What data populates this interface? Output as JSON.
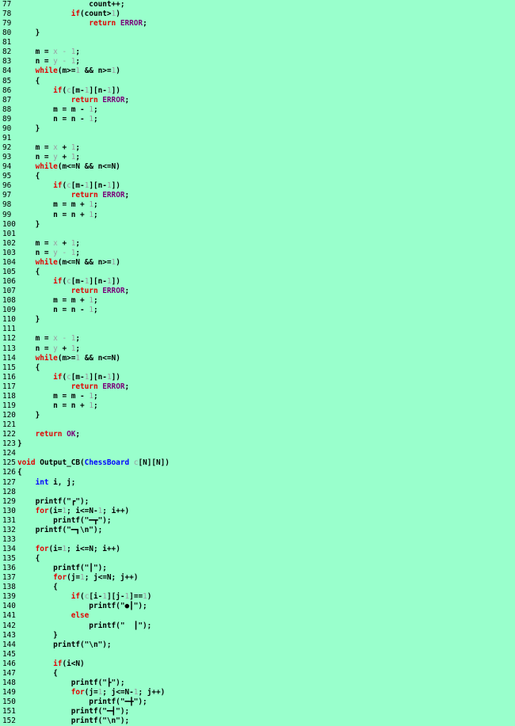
{
  "editor": {
    "colors": {
      "background": "#99ffcc",
      "keyword": "#e00000",
      "type": "#0000ff",
      "number": "#9a9aa0",
      "macro": "#7a007a",
      "text": "#000000"
    },
    "lines": [
      {
        "n": "77",
        "t": [
          [
            "i",
            "                count++;"
          ]
        ]
      },
      {
        "n": "78",
        "t": [
          [
            "i",
            "            "
          ],
          [
            "k",
            "if"
          ],
          [
            "i",
            "(count>"
          ],
          [
            "d",
            "1"
          ],
          [
            "i",
            ")"
          ]
        ]
      },
      {
        "n": "79",
        "t": [
          [
            "i",
            "                "
          ],
          [
            "k",
            "return"
          ],
          [
            "i",
            " "
          ],
          [
            "m",
            "ERROR"
          ],
          [
            "i",
            ";"
          ]
        ]
      },
      {
        "n": "80",
        "t": [
          [
            "i",
            "    }"
          ]
        ]
      },
      {
        "n": "81",
        "t": []
      },
      {
        "n": "82",
        "t": [
          [
            "i",
            "    m = "
          ],
          [
            "d",
            "x - 1"
          ],
          [
            "i",
            ";"
          ]
        ]
      },
      {
        "n": "83",
        "t": [
          [
            "i",
            "    n = "
          ],
          [
            "d",
            "y - 1"
          ],
          [
            "i",
            ";"
          ]
        ]
      },
      {
        "n": "84",
        "t": [
          [
            "i",
            "    "
          ],
          [
            "k",
            "while"
          ],
          [
            "i",
            "(m>="
          ],
          [
            "d",
            "1"
          ],
          [
            "i",
            " && n>="
          ],
          [
            "d",
            "1"
          ],
          [
            "i",
            ")"
          ]
        ]
      },
      {
        "n": "85",
        "t": [
          [
            "i",
            "    {"
          ]
        ]
      },
      {
        "n": "86",
        "t": [
          [
            "i",
            "        "
          ],
          [
            "k",
            "if"
          ],
          [
            "i",
            "("
          ],
          [
            "d",
            "c"
          ],
          [
            "i",
            "[m-"
          ],
          [
            "d",
            "1"
          ],
          [
            "i",
            "][n-"
          ],
          [
            "d",
            "1"
          ],
          [
            "i",
            "])"
          ]
        ]
      },
      {
        "n": "87",
        "t": [
          [
            "i",
            "            "
          ],
          [
            "k",
            "return"
          ],
          [
            "i",
            " "
          ],
          [
            "m",
            "ERROR"
          ],
          [
            "i",
            ";"
          ]
        ]
      },
      {
        "n": "88",
        "t": [
          [
            "i",
            "        m = m - "
          ],
          [
            "d",
            "1"
          ],
          [
            "i",
            ";"
          ]
        ]
      },
      {
        "n": "89",
        "t": [
          [
            "i",
            "        n = n - "
          ],
          [
            "d",
            "1"
          ],
          [
            "i",
            ";"
          ]
        ]
      },
      {
        "n": "90",
        "t": [
          [
            "i",
            "    }"
          ]
        ]
      },
      {
        "n": "91",
        "t": []
      },
      {
        "n": "92",
        "t": [
          [
            "i",
            "    m = "
          ],
          [
            "d",
            "x"
          ],
          [
            "i",
            " + "
          ],
          [
            "d",
            "1"
          ],
          [
            "i",
            ";"
          ]
        ]
      },
      {
        "n": "93",
        "t": [
          [
            "i",
            "    n = "
          ],
          [
            "d",
            "y"
          ],
          [
            "i",
            " + "
          ],
          [
            "d",
            "1"
          ],
          [
            "i",
            ";"
          ]
        ]
      },
      {
        "n": "94",
        "t": [
          [
            "i",
            "    "
          ],
          [
            "k",
            "while"
          ],
          [
            "i",
            "(m<=N && n<=N)"
          ]
        ]
      },
      {
        "n": "95",
        "t": [
          [
            "i",
            "    {"
          ]
        ]
      },
      {
        "n": "96",
        "t": [
          [
            "i",
            "        "
          ],
          [
            "k",
            "if"
          ],
          [
            "i",
            "("
          ],
          [
            "d",
            "c"
          ],
          [
            "i",
            "[m-"
          ],
          [
            "d",
            "1"
          ],
          [
            "i",
            "][n-"
          ],
          [
            "d",
            "1"
          ],
          [
            "i",
            "])"
          ]
        ]
      },
      {
        "n": "97",
        "t": [
          [
            "i",
            "            "
          ],
          [
            "k",
            "return"
          ],
          [
            "i",
            " "
          ],
          [
            "m",
            "ERROR"
          ],
          [
            "i",
            ";"
          ]
        ]
      },
      {
        "n": "98",
        "t": [
          [
            "i",
            "        m = m + "
          ],
          [
            "d",
            "1"
          ],
          [
            "i",
            ";"
          ]
        ]
      },
      {
        "n": "99",
        "t": [
          [
            "i",
            "        n = n + "
          ],
          [
            "d",
            "1"
          ],
          [
            "i",
            ";"
          ]
        ]
      },
      {
        "n": "100",
        "t": [
          [
            "i",
            "    }"
          ]
        ]
      },
      {
        "n": "101",
        "t": []
      },
      {
        "n": "102",
        "t": [
          [
            "i",
            "    m = "
          ],
          [
            "d",
            "x"
          ],
          [
            "i",
            " + "
          ],
          [
            "d",
            "1"
          ],
          [
            "i",
            ";"
          ]
        ]
      },
      {
        "n": "103",
        "t": [
          [
            "i",
            "    n = "
          ],
          [
            "d",
            "y - 1"
          ],
          [
            "i",
            ";"
          ]
        ]
      },
      {
        "n": "104",
        "t": [
          [
            "i",
            "    "
          ],
          [
            "k",
            "while"
          ],
          [
            "i",
            "(m<=N && n>="
          ],
          [
            "d",
            "1"
          ],
          [
            "i",
            ")"
          ]
        ]
      },
      {
        "n": "105",
        "t": [
          [
            "i",
            "    {"
          ]
        ]
      },
      {
        "n": "106",
        "t": [
          [
            "i",
            "        "
          ],
          [
            "k",
            "if"
          ],
          [
            "i",
            "("
          ],
          [
            "d",
            "c"
          ],
          [
            "i",
            "[m-"
          ],
          [
            "d",
            "1"
          ],
          [
            "i",
            "][n-"
          ],
          [
            "d",
            "1"
          ],
          [
            "i",
            "])"
          ]
        ]
      },
      {
        "n": "107",
        "t": [
          [
            "i",
            "            "
          ],
          [
            "k",
            "return"
          ],
          [
            "i",
            " "
          ],
          [
            "m",
            "ERROR"
          ],
          [
            "i",
            ";"
          ]
        ]
      },
      {
        "n": "108",
        "t": [
          [
            "i",
            "        m = m + "
          ],
          [
            "d",
            "1"
          ],
          [
            "i",
            ";"
          ]
        ]
      },
      {
        "n": "109",
        "t": [
          [
            "i",
            "        n = n - "
          ],
          [
            "d",
            "1"
          ],
          [
            "i",
            ";"
          ]
        ]
      },
      {
        "n": "110",
        "t": [
          [
            "i",
            "    }"
          ]
        ]
      },
      {
        "n": "111",
        "t": []
      },
      {
        "n": "112",
        "t": [
          [
            "i",
            "    m = "
          ],
          [
            "d",
            "x - 1"
          ],
          [
            "i",
            ";"
          ]
        ]
      },
      {
        "n": "113",
        "t": [
          [
            "i",
            "    n = "
          ],
          [
            "d",
            "y"
          ],
          [
            "i",
            " + "
          ],
          [
            "d",
            "1"
          ],
          [
            "i",
            ";"
          ]
        ]
      },
      {
        "n": "114",
        "t": [
          [
            "i",
            "    "
          ],
          [
            "k",
            "while"
          ],
          [
            "i",
            "(m>="
          ],
          [
            "d",
            "1"
          ],
          [
            "i",
            " && n<=N)"
          ]
        ]
      },
      {
        "n": "115",
        "t": [
          [
            "i",
            "    {"
          ]
        ]
      },
      {
        "n": "116",
        "t": [
          [
            "i",
            "        "
          ],
          [
            "k",
            "if"
          ],
          [
            "i",
            "("
          ],
          [
            "d",
            "c"
          ],
          [
            "i",
            "[m-"
          ],
          [
            "d",
            "1"
          ],
          [
            "i",
            "][n-"
          ],
          [
            "d",
            "1"
          ],
          [
            "i",
            "])"
          ]
        ]
      },
      {
        "n": "117",
        "t": [
          [
            "i",
            "            "
          ],
          [
            "k",
            "return"
          ],
          [
            "i",
            " "
          ],
          [
            "m",
            "ERROR"
          ],
          [
            "i",
            ";"
          ]
        ]
      },
      {
        "n": "118",
        "t": [
          [
            "i",
            "        m = m - "
          ],
          [
            "d",
            "1"
          ],
          [
            "i",
            ";"
          ]
        ]
      },
      {
        "n": "119",
        "t": [
          [
            "i",
            "        n = n + "
          ],
          [
            "d",
            "1"
          ],
          [
            "i",
            ";"
          ]
        ]
      },
      {
        "n": "120",
        "t": [
          [
            "i",
            "    }"
          ]
        ]
      },
      {
        "n": "121",
        "t": []
      },
      {
        "n": "122",
        "t": [
          [
            "i",
            "    "
          ],
          [
            "k",
            "return"
          ],
          [
            "i",
            " "
          ],
          [
            "m",
            "OK"
          ],
          [
            "i",
            ";"
          ]
        ]
      },
      {
        "n": "123",
        "t": [
          [
            "i",
            "}"
          ]
        ]
      },
      {
        "n": "124",
        "t": []
      },
      {
        "n": "125",
        "t": [
          [
            "k",
            "void"
          ],
          [
            "i",
            " Output_CB("
          ],
          [
            "t",
            "ChessBoard"
          ],
          [
            "i",
            " "
          ],
          [
            "d",
            "c"
          ],
          [
            "i",
            "[N][N])"
          ]
        ]
      },
      {
        "n": "126",
        "t": [
          [
            "i",
            "{"
          ]
        ]
      },
      {
        "n": "127",
        "t": [
          [
            "i",
            "    "
          ],
          [
            "t",
            "int"
          ],
          [
            "i",
            " i, j;"
          ]
        ]
      },
      {
        "n": "128",
        "t": []
      },
      {
        "n": "129",
        "t": [
          [
            "i",
            "    printf(\"┏\");"
          ]
        ]
      },
      {
        "n": "130",
        "t": [
          [
            "i",
            "    "
          ],
          [
            "k",
            "for"
          ],
          [
            "i",
            "(i="
          ],
          [
            "d",
            "1"
          ],
          [
            "i",
            "; i<=N-"
          ],
          [
            "d",
            "1"
          ],
          [
            "i",
            "; i++)"
          ]
        ]
      },
      {
        "n": "131",
        "t": [
          [
            "i",
            "        printf(\"━┳\");"
          ]
        ]
      },
      {
        "n": "132",
        "t": [
          [
            "i",
            "    printf(\"━┓\\n\");"
          ]
        ]
      },
      {
        "n": "133",
        "t": []
      },
      {
        "n": "134",
        "t": [
          [
            "i",
            "    "
          ],
          [
            "k",
            "for"
          ],
          [
            "i",
            "(i="
          ],
          [
            "d",
            "1"
          ],
          [
            "i",
            "; i<=N; i++)"
          ]
        ]
      },
      {
        "n": "135",
        "t": [
          [
            "i",
            "    {"
          ]
        ]
      },
      {
        "n": "136",
        "t": [
          [
            "i",
            "        printf(\"┃\");"
          ]
        ]
      },
      {
        "n": "137",
        "t": [
          [
            "i",
            "        "
          ],
          [
            "k",
            "for"
          ],
          [
            "i",
            "(j="
          ],
          [
            "d",
            "1"
          ],
          [
            "i",
            "; j<=N; j++)"
          ]
        ]
      },
      {
        "n": "138",
        "t": [
          [
            "i",
            "        {"
          ]
        ]
      },
      {
        "n": "139",
        "t": [
          [
            "i",
            "            "
          ],
          [
            "k",
            "if"
          ],
          [
            "i",
            "("
          ],
          [
            "d",
            "c"
          ],
          [
            "i",
            "[i-"
          ],
          [
            "d",
            "1"
          ],
          [
            "i",
            "][j-"
          ],
          [
            "d",
            "1"
          ],
          [
            "i",
            "]=="
          ],
          [
            "d",
            "1"
          ],
          [
            "i",
            ")"
          ]
        ]
      },
      {
        "n": "140",
        "t": [
          [
            "i",
            "                printf(\"●┃\");"
          ]
        ]
      },
      {
        "n": "141",
        "t": [
          [
            "i",
            "            "
          ],
          [
            "k",
            "else"
          ]
        ]
      },
      {
        "n": "142",
        "t": [
          [
            "i",
            "                printf(\"  ┃\");"
          ]
        ]
      },
      {
        "n": "143",
        "t": [
          [
            "i",
            "        }"
          ]
        ]
      },
      {
        "n": "144",
        "t": [
          [
            "i",
            "        printf(\"\\n\");"
          ]
        ]
      },
      {
        "n": "145",
        "t": []
      },
      {
        "n": "146",
        "t": [
          [
            "i",
            "        "
          ],
          [
            "k",
            "if"
          ],
          [
            "i",
            "(i<N)"
          ]
        ]
      },
      {
        "n": "147",
        "t": [
          [
            "i",
            "        {"
          ]
        ]
      },
      {
        "n": "148",
        "t": [
          [
            "i",
            "            printf(\"┣\");"
          ]
        ]
      },
      {
        "n": "149",
        "t": [
          [
            "i",
            "            "
          ],
          [
            "k",
            "for"
          ],
          [
            "i",
            "(j="
          ],
          [
            "d",
            "1"
          ],
          [
            "i",
            "; j<=N-"
          ],
          [
            "d",
            "1"
          ],
          [
            "i",
            "; j++)"
          ]
        ]
      },
      {
        "n": "150",
        "t": [
          [
            "i",
            "                printf(\"━╋\");"
          ]
        ]
      },
      {
        "n": "151",
        "t": [
          [
            "i",
            "            printf(\"━┫\");"
          ]
        ]
      },
      {
        "n": "152",
        "t": [
          [
            "i",
            "            printf(\"\\n\");"
          ]
        ]
      }
    ]
  }
}
